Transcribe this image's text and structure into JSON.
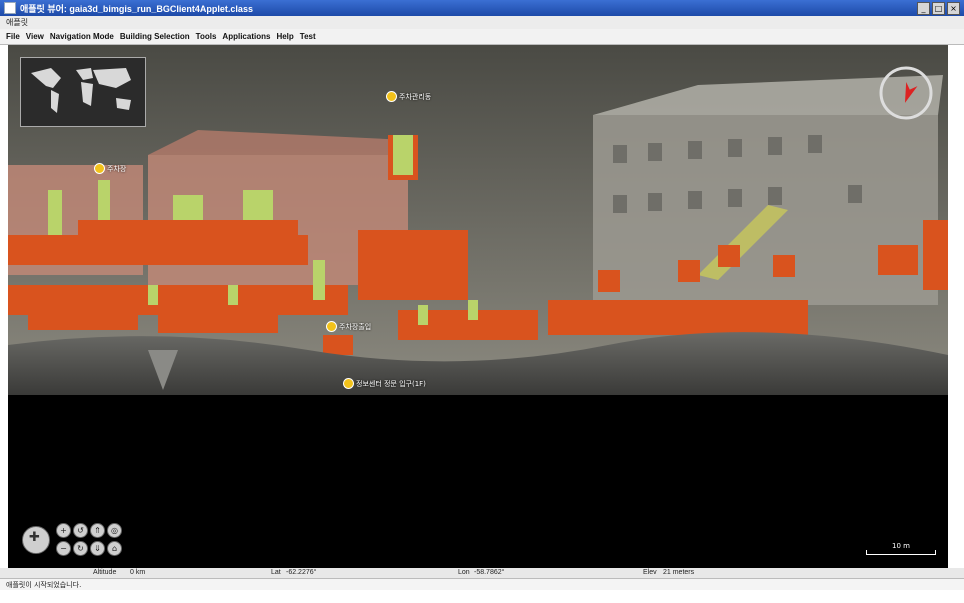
{
  "window": {
    "title": "애플릿 뷰어: gaia3d_bimgis_run_BGClient4Applet.class"
  },
  "applet_label": "애플릿",
  "menu": [
    "File",
    "View",
    "Navigation Mode",
    "Building Selection",
    "Tools",
    "Applications",
    "Help",
    "Test"
  ],
  "pois": [
    "주차관리동",
    "주차장",
    "주차장출입",
    "정보센터 정문 입구(1F)"
  ],
  "scale_label": "10 m",
  "status": {
    "altitude_label": "Altitude",
    "altitude_value": "0 km",
    "lat_label": "Lat",
    "lat_value": "-62.2276°",
    "lon_label": "Lon",
    "lon_value": "-58.7862°",
    "elev_label": "Elev",
    "elev_value": "21 meters"
  },
  "message": "애플릿이 시작되었습니다."
}
